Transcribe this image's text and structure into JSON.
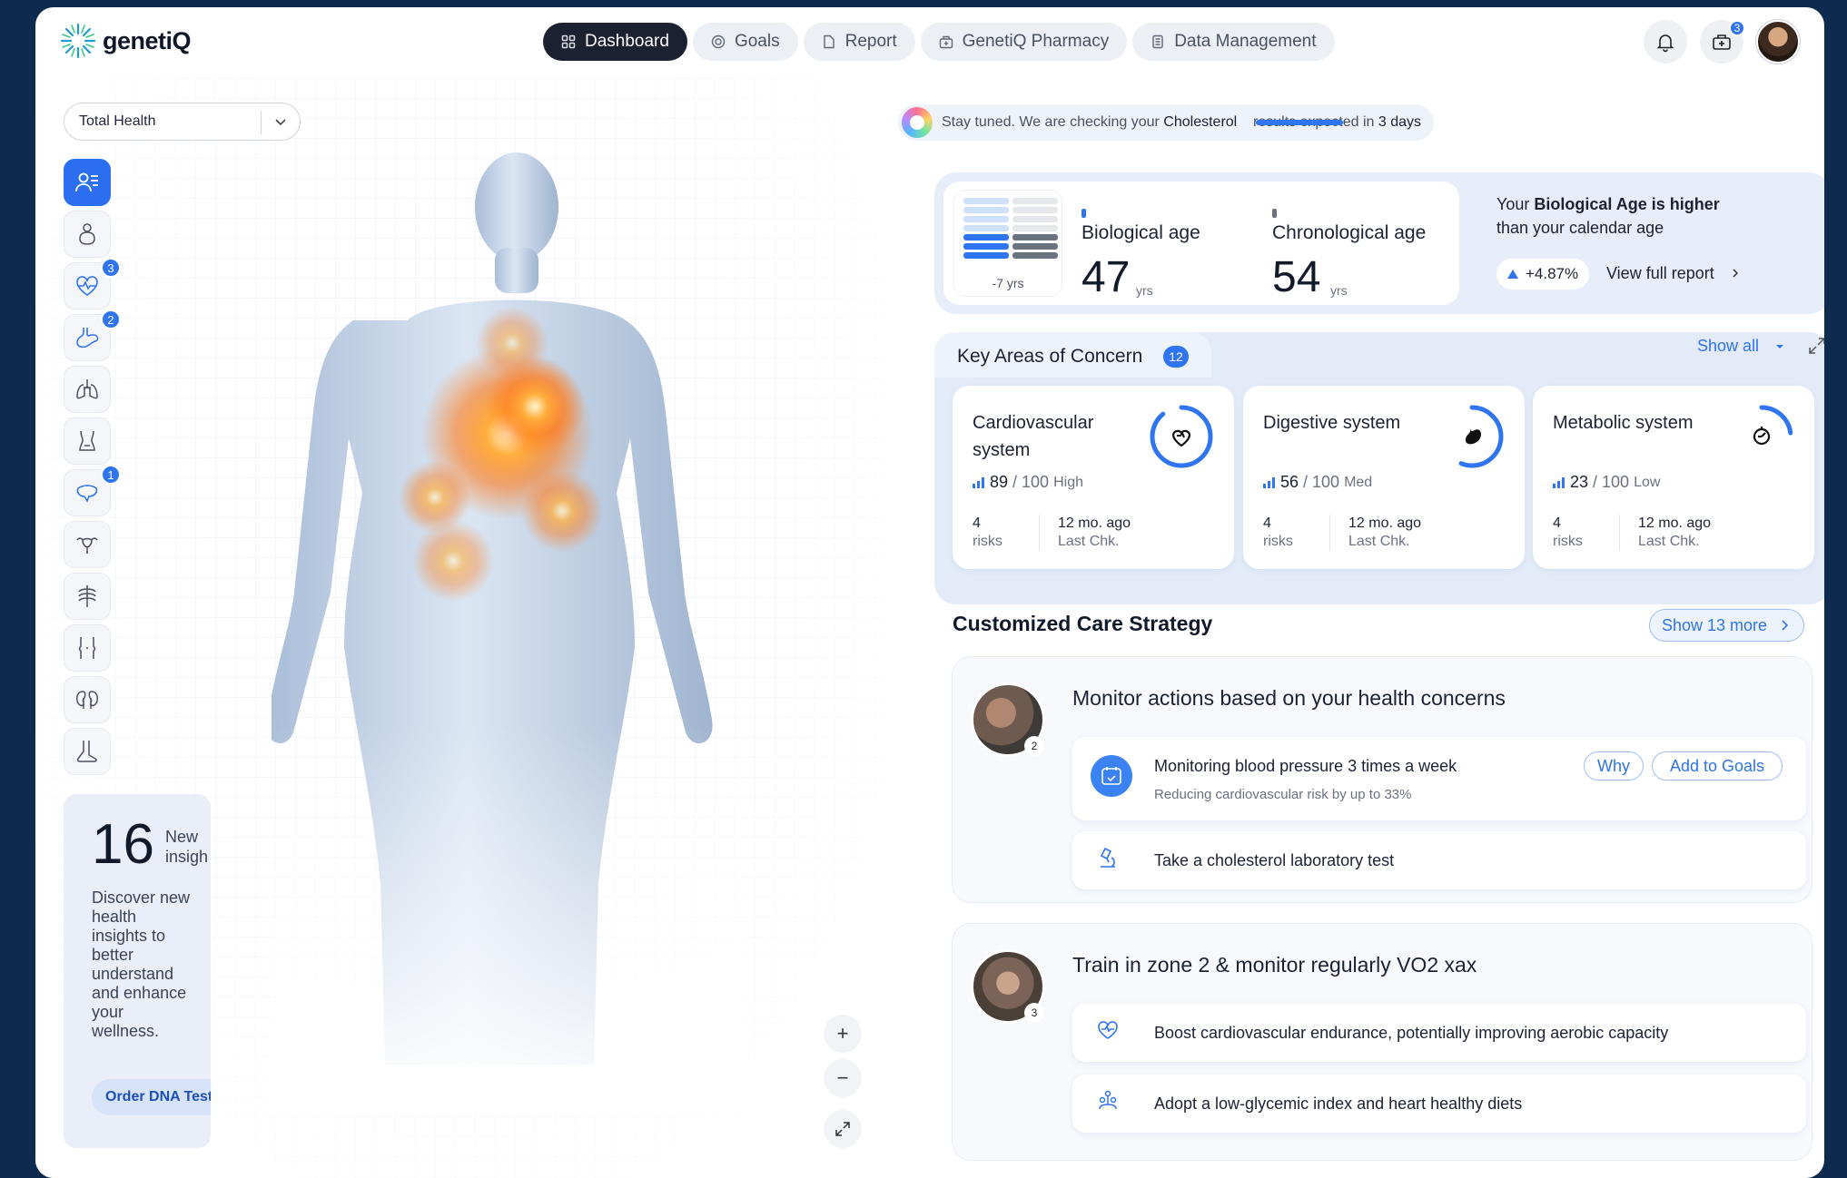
{
  "app": {
    "brand": "genetiQ"
  },
  "nav": {
    "tabs": [
      {
        "label": "Dashboard",
        "icon": "grid-icon",
        "active": true
      },
      {
        "label": "Goals",
        "icon": "target-icon",
        "active": false
      },
      {
        "label": "Report",
        "icon": "document-icon",
        "active": false
      },
      {
        "label": "GenetiQ Pharmacy",
        "icon": "pharmacy-icon",
        "active": false
      },
      {
        "label": "Data Management",
        "icon": "database-icon",
        "active": false
      }
    ]
  },
  "header": {
    "notifications_icon": "bell-icon",
    "cart_icon": "cart-icon",
    "cart_count": "3"
  },
  "body_panel": {
    "selector_value": "Total Health",
    "sidebar": [
      {
        "icon": "profile-list-icon",
        "badge": ""
      },
      {
        "icon": "organs-icon",
        "badge": ""
      },
      {
        "icon": "heart-pulse-icon",
        "badge": "3"
      },
      {
        "icon": "stomach-icon",
        "badge": "2"
      },
      {
        "icon": "lungs-icon",
        "badge": ""
      },
      {
        "icon": "bladder-icon",
        "badge": ""
      },
      {
        "icon": "liver-icon",
        "badge": "1"
      },
      {
        "icon": "uterus-icon",
        "badge": ""
      },
      {
        "icon": "ribcage-icon",
        "badge": ""
      },
      {
        "icon": "joints-icon",
        "badge": ""
      },
      {
        "icon": "kidneys-icon",
        "badge": ""
      },
      {
        "icon": "leg-icon",
        "badge": ""
      }
    ],
    "insight": {
      "count": "16",
      "label": "New insigh",
      "desc": "Discover new health insights to better understand and enhance your wellness.",
      "button": "Order DNA Test"
    },
    "zoom": {
      "in": "+",
      "out": "−",
      "expand": "expand-icon"
    }
  },
  "status": {
    "prefix": "Stay tuned. We are checking your",
    "subject": "Cholesterol",
    "suffix": "results expected in",
    "when": "3 days"
  },
  "bio_age": {
    "delta_label": "-7 yrs",
    "biological_label": "Biological age",
    "biological_value": "47",
    "chronological_label": "Chronological age",
    "chronological_value": "54",
    "unit": "yrs",
    "message_pre": "Your",
    "message_bold": "Biological Age is higher",
    "message_post": "than your calendar age",
    "change": "+4.87%",
    "view_report": "View full report"
  },
  "key_areas": {
    "title": "Key Areas of Concern",
    "count": "12",
    "show_all": "Show all",
    "cards": [
      {
        "name": "Cardiovascular system",
        "score": "89",
        "max": "100",
        "level": "High",
        "risks": "4",
        "risks_label": "risks",
        "last": "12 mo. ago",
        "last_label": "Last Chk.",
        "progress": 0.89,
        "icon": "heart-icon"
      },
      {
        "name": "Digestive system",
        "score": "56",
        "max": "100",
        "level": "Med",
        "risks": "4",
        "risks_label": "risks",
        "last": "12 mo. ago",
        "last_label": "Last Chk.",
        "progress": 0.56,
        "icon": "stomach-icon"
      },
      {
        "name": "Metabolic system",
        "score": "23",
        "max": "100",
        "level": "Low",
        "risks": "4",
        "risks_label": "risks",
        "last": "12 mo. ago",
        "last_label": "Last Chk.",
        "progress": 0.23,
        "icon": "metabolism-icon"
      }
    ]
  },
  "care": {
    "title": "Customized Care Strategy",
    "show_more": "Show 13 more",
    "strategies": [
      {
        "title": "Monitor actions based on your health concerns",
        "photo_count": "2",
        "actions": [
          {
            "text": "Monitoring blood pressure 3 times a week",
            "sub": "Reducing cardiovascular risk by up to 33%",
            "why": "Why",
            "add": "Add to Goals",
            "icon": "blood-pressure-icon"
          },
          {
            "text": "Take a cholesterol laboratory test",
            "icon": "microscope-icon"
          }
        ]
      },
      {
        "title": "Train in zone 2 & monitor regularly VO2 xax",
        "photo_count": "3",
        "actions": [
          {
            "text": "Boost cardiovascular endurance, potentially improving aerobic capacity",
            "icon": "heart-outline-icon"
          },
          {
            "text": "Adopt a low-glycemic index and heart healthy diets",
            "icon": "diet-icon"
          }
        ]
      }
    ]
  },
  "colors": {
    "accent": "#2f74f0",
    "dark": "#1b2130",
    "hotspot": "#ff7a1a"
  }
}
